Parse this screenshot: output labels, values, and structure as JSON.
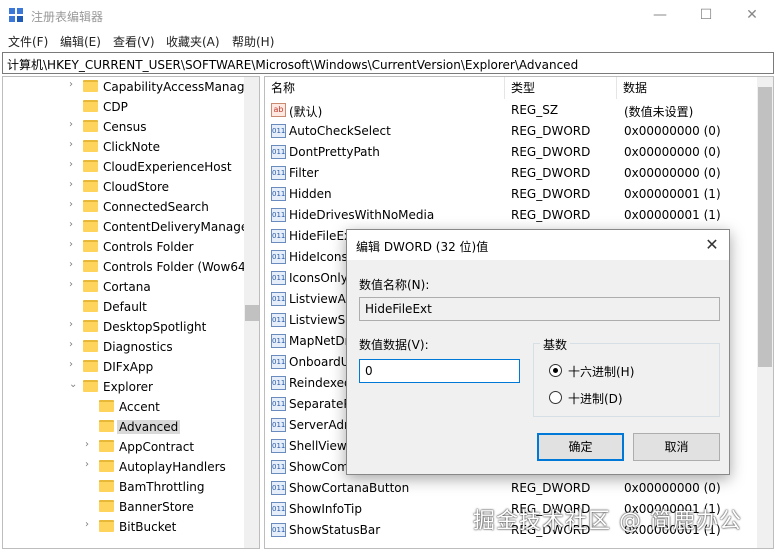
{
  "window": {
    "title": "注册表编辑器",
    "minimize_icon": "minimize-icon",
    "maximize_icon": "maximize-icon",
    "close_icon": "close-icon",
    "min_glyph": "—",
    "max_glyph": "☐",
    "close_glyph": "✕"
  },
  "menu": [
    "文件(F)",
    "编辑(E)",
    "查看(V)",
    "收藏夹(A)",
    "帮助(H)"
  ],
  "address": "计算机\\HKEY_CURRENT_USER\\SOFTWARE\\Microsoft\\Windows\\CurrentVersion\\Explorer\\Advanced",
  "tree": {
    "items": [
      {
        "label": "CapabilityAccessManag",
        "expandable": true
      },
      {
        "label": "CDP",
        "expandable": false
      },
      {
        "label": "Census",
        "expandable": true
      },
      {
        "label": "ClickNote",
        "expandable": true
      },
      {
        "label": "CloudExperienceHost",
        "expandable": true
      },
      {
        "label": "CloudStore",
        "expandable": true
      },
      {
        "label": "ConnectedSearch",
        "expandable": true
      },
      {
        "label": "ContentDeliveryManage",
        "expandable": true
      },
      {
        "label": "Controls Folder",
        "expandable": true
      },
      {
        "label": "Controls Folder (Wow64",
        "expandable": true
      },
      {
        "label": "Cortana",
        "expandable": true
      },
      {
        "label": "Default",
        "expandable": false
      },
      {
        "label": "DesktopSpotlight",
        "expandable": true
      },
      {
        "label": "Diagnostics",
        "expandable": true
      },
      {
        "label": "DIFxApp",
        "expandable": true
      },
      {
        "label": "Explorer",
        "expandable": true,
        "expanded": true
      },
      {
        "label": "Accent",
        "expandable": false,
        "child": true
      },
      {
        "label": "Advanced",
        "expandable": false,
        "child": true,
        "selected": true
      },
      {
        "label": "AppContract",
        "expandable": true,
        "child": true
      },
      {
        "label": "AutoplayHandlers",
        "expandable": true,
        "child": true
      },
      {
        "label": "BamThrottling",
        "expandable": false,
        "child": true
      },
      {
        "label": "BannerStore",
        "expandable": false,
        "child": true
      },
      {
        "label": "BitBucket",
        "expandable": true,
        "child": true
      }
    ]
  },
  "list": {
    "columns": [
      "名称",
      "类型",
      "数据"
    ],
    "rows": [
      {
        "icon": "ab",
        "name": "(默认)",
        "type": "REG_SZ",
        "data": "(数值未设置)"
      },
      {
        "icon": "dw",
        "name": "AutoCheckSelect",
        "type": "REG_DWORD",
        "data": "0x00000000 (0)"
      },
      {
        "icon": "dw",
        "name": "DontPrettyPath",
        "type": "REG_DWORD",
        "data": "0x00000000 (0)"
      },
      {
        "icon": "dw",
        "name": "Filter",
        "type": "REG_DWORD",
        "data": "0x00000000 (0)"
      },
      {
        "icon": "dw",
        "name": "Hidden",
        "type": "REG_DWORD",
        "data": "0x00000001 (1)"
      },
      {
        "icon": "dw",
        "name": "HideDrivesWithNoMedia",
        "type": "REG_DWORD",
        "data": "0x00000001 (1)"
      },
      {
        "icon": "dw",
        "name": "HideFileEx",
        "type": "",
        "data": ""
      },
      {
        "icon": "dw",
        "name": "HideIcons",
        "type": "",
        "data": ""
      },
      {
        "icon": "dw",
        "name": "IconsOnly",
        "type": "",
        "data": ""
      },
      {
        "icon": "dw",
        "name": "ListviewAlp",
        "type": "",
        "data": ""
      },
      {
        "icon": "dw",
        "name": "ListviewSh",
        "type": "",
        "data": ""
      },
      {
        "icon": "dw",
        "name": "MapNetDr",
        "type": "",
        "data": ""
      },
      {
        "icon": "dw",
        "name": "OnboardU",
        "type": "",
        "data": ""
      },
      {
        "icon": "dw",
        "name": "Reindexed",
        "type": "",
        "data": ""
      },
      {
        "icon": "dw",
        "name": "SeparateP",
        "type": "",
        "data": ""
      },
      {
        "icon": "dw",
        "name": "ServerAdm",
        "type": "",
        "data": ""
      },
      {
        "icon": "dw",
        "name": "ShellViewF",
        "type": "",
        "data": ""
      },
      {
        "icon": "dw",
        "name": "ShowCom",
        "type": "",
        "data": ""
      },
      {
        "icon": "dw",
        "name": "ShowCortanaButton",
        "type": "REG_DWORD",
        "data": "0x00000000 (0)"
      },
      {
        "icon": "dw",
        "name": "ShowInfoTip",
        "type": "REG_DWORD",
        "data": "0x00000001 (1)"
      },
      {
        "icon": "dw",
        "name": "ShowStatusBar",
        "type": "REG_DWORD",
        "data": "0x00000001 (1)"
      }
    ]
  },
  "dialog": {
    "title": "编辑 DWORD (32 位)值",
    "name_label": "数值名称(N):",
    "name_value": "HideFileExt",
    "data_label": "数值数据(V):",
    "data_value": "0",
    "base_label": "基数",
    "hex_label": "十六进制(H)",
    "dec_label": "十进制(D)",
    "selected_base": "hex",
    "ok_label": "确定",
    "cancel_label": "取消"
  },
  "watermark": "掘金技术社区 @ 简鹿办公",
  "colors": {
    "accent": "#0078d7",
    "folder": "#ffd45c",
    "selection": "#d9d9d9"
  }
}
